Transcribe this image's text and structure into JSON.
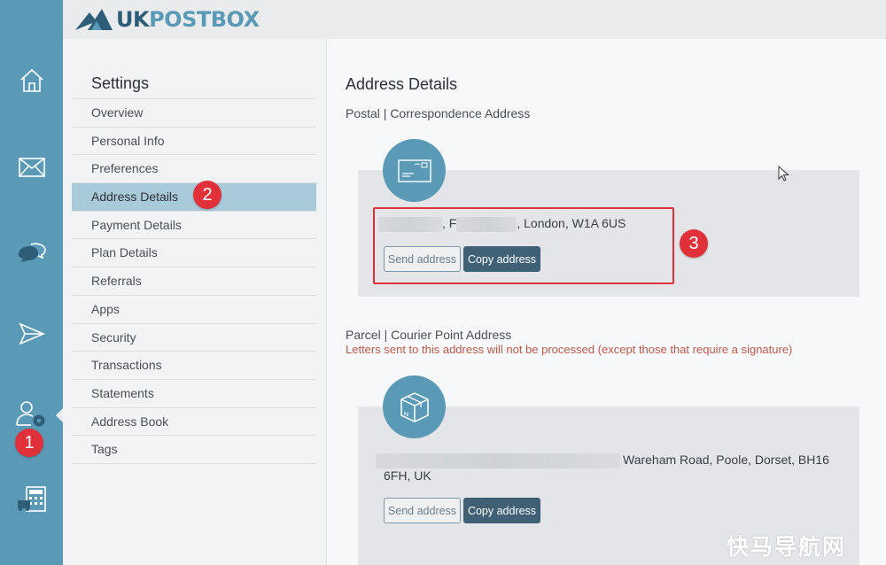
{
  "app": {
    "logo_uk": "UK",
    "logo_postbox": "POSTBOX"
  },
  "rail": {
    "icons": [
      "home-icon",
      "mail-icon",
      "chat-icon",
      "send-icon",
      "account-settings-icon",
      "calculator-icon"
    ]
  },
  "settings": {
    "title": "Settings",
    "items": [
      {
        "label": "Overview"
      },
      {
        "label": "Personal Info"
      },
      {
        "label": "Preferences"
      },
      {
        "label": "Address Details",
        "active": true
      },
      {
        "label": "Payment Details"
      },
      {
        "label": "Plan Details"
      },
      {
        "label": "Referrals"
      },
      {
        "label": "Apps"
      },
      {
        "label": "Security"
      },
      {
        "label": "Transactions"
      },
      {
        "label": "Statements"
      },
      {
        "label": "Address Book"
      },
      {
        "label": "Tags"
      }
    ]
  },
  "main": {
    "title": "Address Details",
    "postal": {
      "heading": "Postal | Correspondence Address",
      "address_sep1": ", F",
      "address_rest": ", London, W1A 6US",
      "send_label": "Send address",
      "copy_label": "Copy address"
    },
    "parcel": {
      "heading": "Parcel | Courier Point Address",
      "warning": "Letters sent to this address will not be processed (except those that require a signature)",
      "address_line1": "Wareham Road, Poole, Dorset, BH16",
      "address_line2": "6FH, UK",
      "send_label": "Send address",
      "copy_label": "Copy address"
    }
  },
  "annotations": {
    "badge1": "1",
    "badge2": "2",
    "badge3": "3"
  },
  "watermark": "快马导航网",
  "colors": {
    "rail": "#5b9ab7",
    "active_item": "#a9cad9",
    "primary_button": "#3f6075",
    "annotation_red": "#e0313a",
    "warning_text": "#c0584a"
  }
}
